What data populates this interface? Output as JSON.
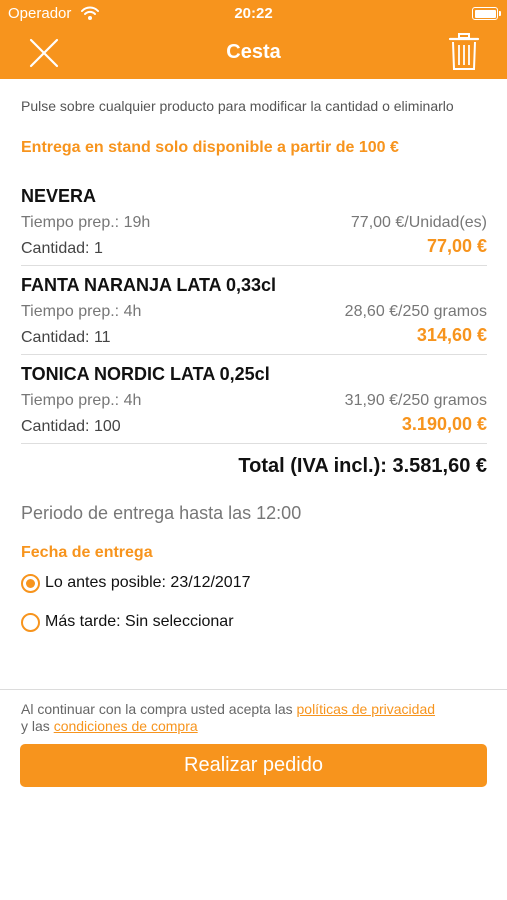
{
  "status_bar": {
    "carrier": "Operador",
    "time": "20:22",
    "icons": [
      "wifi-icon",
      "battery-icon"
    ]
  },
  "header": {
    "title": "Cesta",
    "close_icon": "close-icon",
    "delete_icon": "trash-icon"
  },
  "info_text": "Pulse sobre cualquier producto para modificar la cantidad o eliminarlo",
  "delivery_notice": "Entrega en stand solo disponible a partir de 100 €",
  "items": [
    {
      "name": "NEVERA",
      "prep_time": "Tiempo prep.: 19h",
      "unit_price": "77,00 €/Unidad(es)",
      "quantity": "Cantidad: 1",
      "total": "77,00 €"
    },
    {
      "name": "FANTA NARANJA LATA 0,33cl",
      "prep_time": "Tiempo prep.: 4h",
      "unit_price": "28,60 €/250 gramos",
      "quantity": "Cantidad: 11",
      "total": "314,60 €"
    },
    {
      "name": "TONICA NORDIC LATA 0,25cl",
      "prep_time": "Tiempo prep.: 4h",
      "unit_price": "31,90 €/250 gramos",
      "quantity": "Cantidad: 100",
      "total": "3.190,00 €"
    }
  ],
  "total": "Total (IVA incl.): 3.581,60 €",
  "delivery_period": "Periodo de entrega hasta las 12:00",
  "delivery_date": {
    "label": "Fecha de entrega",
    "options": [
      {
        "label": "Lo antes posible: 23/12/2017",
        "selected": true
      },
      {
        "label": "Más tarde: Sin seleccionar",
        "selected": false
      }
    ]
  },
  "terms": {
    "prefix": "Al continuar con la compra usted acepta las ",
    "privacy_link": "políticas de privacidad",
    "middle": " y las ",
    "conditions_link": "condiciones de compra"
  },
  "order_button": "Realizar pedido",
  "colors": {
    "accent": "#f7941d",
    "text": "#111111",
    "muted": "#777777"
  }
}
